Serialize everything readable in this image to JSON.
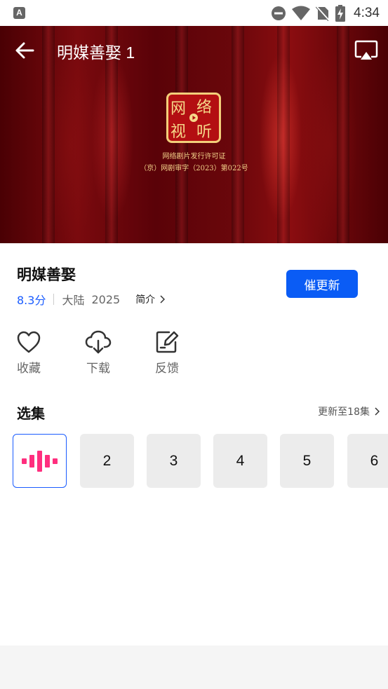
{
  "status_bar": {
    "app_icon_letter": "A",
    "time": "4:34",
    "icons": [
      "dnd-icon",
      "wifi-icon",
      "no-sim-icon",
      "battery-charging-icon"
    ]
  },
  "player": {
    "title": "明媒善娶 1",
    "seal_chars": [
      "网",
      "络",
      "视",
      "听"
    ],
    "license_line1": "网络剧片发行许可证",
    "license_line2": "（京）网剧审字（2023）第022号"
  },
  "show": {
    "title": "明媒善娶",
    "rating": "8.3分",
    "region": "大陆",
    "year": "2025",
    "intro_label": "简介",
    "urge_button": "催更新"
  },
  "actions": [
    {
      "label": "收藏",
      "icon": "heart-icon"
    },
    {
      "label": "下载",
      "icon": "cloud-download-icon"
    },
    {
      "label": "反馈",
      "icon": "feedback-edit-icon"
    }
  ],
  "episodes": {
    "header": "选集",
    "update_text": "更新至18集",
    "items": [
      "",
      "2",
      "3",
      "4",
      "5",
      "6"
    ],
    "playing_index": 0,
    "accent": "#ff2e7e"
  },
  "colors": {
    "primary": "#0a5cf5",
    "rating": "#1a5cff"
  }
}
